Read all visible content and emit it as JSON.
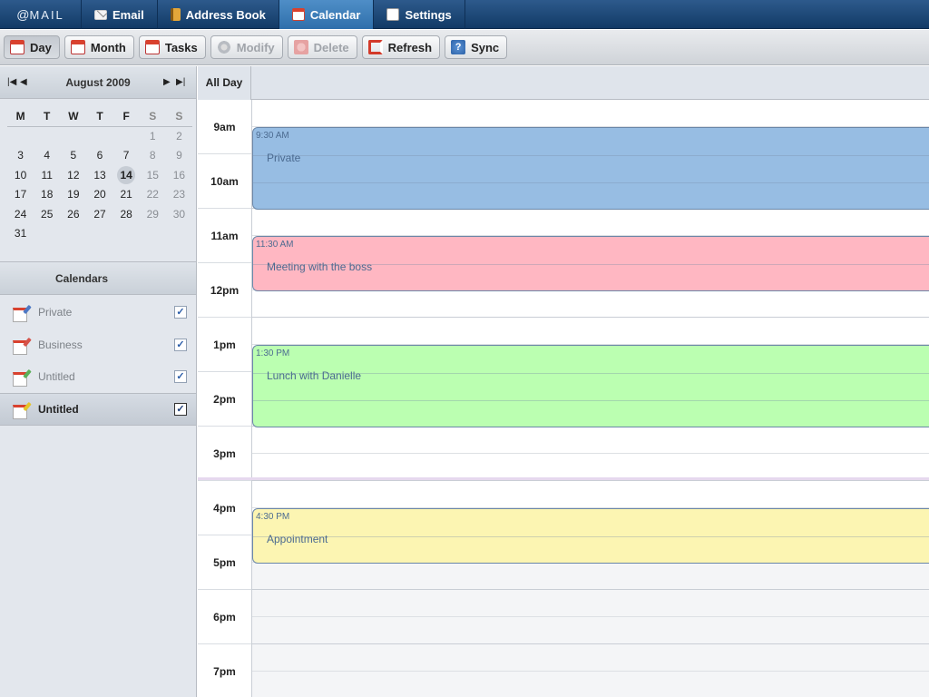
{
  "nav": {
    "logo_at": "@",
    "logo_text": "MAIL",
    "tabs": [
      {
        "label": "Email"
      },
      {
        "label": "Address Book"
      },
      {
        "label": "Calendar"
      },
      {
        "label": "Settings"
      }
    ]
  },
  "toolbar": {
    "day": "Day",
    "month": "Month",
    "tasks": "Tasks",
    "modify": "Modify",
    "delete": "Delete",
    "refresh": "Refresh",
    "sync": "Sync",
    "help_glyph": "?"
  },
  "mini_calendar": {
    "title": "August 2009",
    "weekdays": [
      "M",
      "T",
      "W",
      "T",
      "F",
      "S",
      "S"
    ],
    "weeks": [
      [
        "",
        "",
        "",
        "",
        "",
        "1",
        "2"
      ],
      [
        "3",
        "4",
        "5",
        "6",
        "7",
        "8",
        "9"
      ],
      [
        "10",
        "11",
        "12",
        "13",
        "14",
        "15",
        "16"
      ],
      [
        "17",
        "18",
        "19",
        "20",
        "21",
        "22",
        "23"
      ],
      [
        "24",
        "25",
        "26",
        "27",
        "28",
        "29",
        "30"
      ],
      [
        "31",
        "",
        "",
        "",
        "",
        "",
        ""
      ]
    ],
    "today": "14"
  },
  "calendars": {
    "title": "Calendars",
    "items": [
      {
        "label": "Private",
        "checked": "✓"
      },
      {
        "label": "Business",
        "checked": "✓"
      },
      {
        "label": "Untitled",
        "checked": "✓"
      },
      {
        "label": "Untitled",
        "checked": "✓"
      }
    ]
  },
  "dayview": {
    "all_day": "All Day",
    "hours": [
      "9am",
      "10am",
      "11am",
      "12pm",
      "1pm",
      "2pm",
      "3pm",
      "4pm",
      "5pm",
      "6pm",
      "7pm"
    ],
    "events": [
      {
        "time": "9:30 AM",
        "title": "Private",
        "color": "#97bde3"
      },
      {
        "time": "11:30 AM",
        "title": "Meeting with the boss",
        "color": "#ffb7c2"
      },
      {
        "time": "1:30 PM",
        "title": "Lunch with Danielle",
        "color": "#bbffb1"
      },
      {
        "time": "4:30 PM",
        "title": "Appointment",
        "color": "#fcf5b2"
      }
    ]
  }
}
